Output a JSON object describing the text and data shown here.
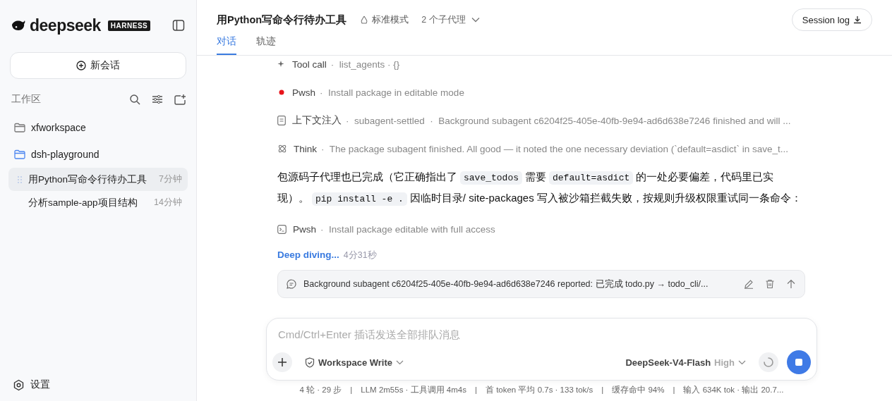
{
  "sidebar": {
    "logo": "deepseek",
    "badge": "HARNESS",
    "new_chat": "新会话",
    "workspace_label": "工作区",
    "workspaces": [
      {
        "name": "xfworkspace",
        "expanded": false
      },
      {
        "name": "dsh-playground",
        "expanded": true,
        "children": [
          {
            "title": "用Python写命令行待办工具",
            "time": "7分钟",
            "selected": true
          },
          {
            "title": "分析sample-app项目结构",
            "time": "14分钟",
            "selected": false
          }
        ]
      }
    ],
    "settings": "设置"
  },
  "header": {
    "title": "用Python写命令行待办工具",
    "mode": "标准模式",
    "subagents": "2 个子代理",
    "session_log": "Session log",
    "tabs": [
      {
        "label": "对话",
        "selected": true
      },
      {
        "label": "轨迹",
        "selected": false
      }
    ]
  },
  "steps": [
    {
      "kind": "tool",
      "label": "Tool call",
      "detail": "·  list_agents · {}"
    },
    {
      "kind": "running",
      "label": "Pwsh",
      "detail": "·  Install package in editable mode"
    },
    {
      "kind": "context",
      "label": "上下文注入",
      "detail": "·  subagent-settled  ·  Background subagent c6204f25-405e-40fb-9e94-ad6d638e7246 finished and will ..."
    },
    {
      "kind": "think",
      "label": "Think",
      "detail": "·  The package subagent finished. All good — it noted the one necessary deviation (`default=asdict` in save_t..."
    }
  ],
  "message": [
    {
      "text": "包源码子代理也已完成（它正确指出了",
      "kind": "text"
    },
    {
      "text": "save_todos",
      "kind": "code"
    },
    {
      "text": "需要",
      "kind": "text"
    },
    {
      "text": "default=asdict",
      "kind": "code"
    },
    {
      "text": "的一处必要偏差，代码里已实现）。",
      "kind": "text"
    },
    {
      "text": "pip install -e .",
      "kind": "code"
    },
    {
      "text": "因临时目录/ site-packages 写入被沙箱拦截失败，按规则升级权限重试同一条命令：",
      "kind": "text"
    }
  ],
  "steps2": [
    {
      "kind": "terminal",
      "label": "Pwsh",
      "detail": "·  Install package editable with full access"
    }
  ],
  "status": {
    "label": "Deep diving...",
    "elapsed": "4分31秒"
  },
  "queued": "Background subagent c6204f25-405e-40fb-9e94-ad6d638e7246 reported: 已完成 todo.py → todo_cli/...",
  "composer": {
    "placeholder": "Cmd/Ctrl+Enter 插话发送全部排队消息",
    "permission": "Workspace Write",
    "model": "DeepSeek-V4-Flash",
    "effort": "High"
  },
  "stats": "4 轮 · 29 步　|　LLM 2m55s · 工具调用 4m4s　|　首 token 平均 0.7s · 133 tok/s　|　缓存命中 94%　|　输入 634K tok · 输出 20.7..."
}
